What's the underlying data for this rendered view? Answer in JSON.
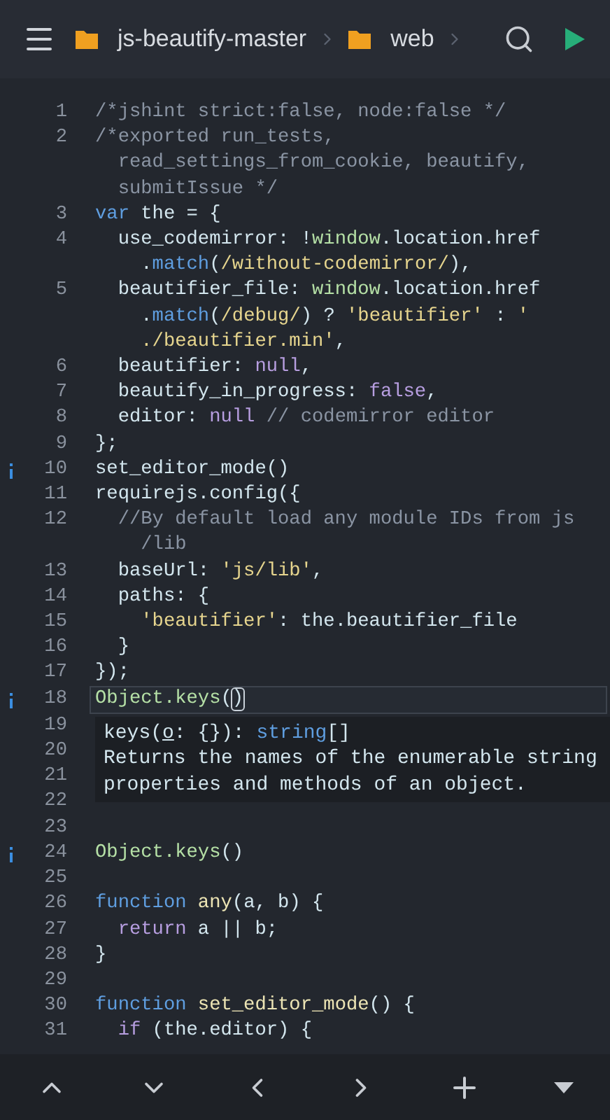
{
  "header": {
    "breadcrumbs": [
      {
        "label": "js-beautify-master"
      },
      {
        "label": "web"
      }
    ]
  },
  "lines": [
    {
      "n": "1",
      "info": false,
      "current": false,
      "rows": [
        {
          "tokens": [
            {
              "text": "/*jshint strict:false, node:false */",
              "kind": "comment"
            }
          ]
        }
      ]
    },
    {
      "n": "2",
      "info": false,
      "current": false,
      "rows": [
        {
          "tokens": [
            {
              "text": "/*exported run_tests,",
              "kind": "comment"
            }
          ]
        },
        {
          "tokens": [
            {
              "text": "  read_settings_from_cookie, beautify,",
              "kind": "comment"
            }
          ]
        },
        {
          "tokens": [
            {
              "text": "  submitIssue */",
              "kind": "comment"
            }
          ]
        }
      ]
    },
    {
      "n": "3",
      "info": false,
      "current": false,
      "rows": [
        {
          "tokens": [
            {
              "text": "var",
              "kind": "keyword"
            },
            {
              "text": " the = {",
              "kind": "ident"
            }
          ]
        }
      ]
    },
    {
      "n": "4",
      "info": false,
      "current": false,
      "rows": [
        {
          "tokens": [
            {
              "text": "  use_codemirror: !",
              "kind": "ident"
            },
            {
              "text": "window",
              "kind": "global"
            },
            {
              "text": ".location.href",
              "kind": "ident"
            }
          ]
        },
        {
          "tokens": [
            {
              "text": "    .",
              "kind": "ident"
            },
            {
              "text": "match",
              "kind": "method"
            },
            {
              "text": "(",
              "kind": "ident"
            },
            {
              "text": "/without-codemirror/",
              "kind": "string"
            },
            {
              "text": "),",
              "kind": "ident"
            }
          ]
        }
      ]
    },
    {
      "n": "5",
      "info": false,
      "current": false,
      "rows": [
        {
          "tokens": [
            {
              "text": "  beautifier_file: ",
              "kind": "ident"
            },
            {
              "text": "window",
              "kind": "global"
            },
            {
              "text": ".location.href",
              "kind": "ident"
            }
          ]
        },
        {
          "tokens": [
            {
              "text": "    .",
              "kind": "ident"
            },
            {
              "text": "match",
              "kind": "method"
            },
            {
              "text": "(",
              "kind": "ident"
            },
            {
              "text": "/debug/",
              "kind": "string"
            },
            {
              "text": ") ? ",
              "kind": "ident"
            },
            {
              "text": "'beautifier'",
              "kind": "string"
            },
            {
              "text": " : ",
              "kind": "ident"
            },
            {
              "text": "'",
              "kind": "string"
            }
          ]
        },
        {
          "tokens": [
            {
              "text": "    ./beautifier.min'",
              "kind": "string"
            },
            {
              "text": ",",
              "kind": "ident"
            }
          ]
        }
      ]
    },
    {
      "n": "6",
      "info": false,
      "current": false,
      "rows": [
        {
          "tokens": [
            {
              "text": "  beautifier: ",
              "kind": "ident"
            },
            {
              "text": "null",
              "kind": "literal"
            },
            {
              "text": ",",
              "kind": "ident"
            }
          ]
        }
      ]
    },
    {
      "n": "7",
      "info": false,
      "current": false,
      "rows": [
        {
          "tokens": [
            {
              "text": "  beautify_in_progress: ",
              "kind": "ident"
            },
            {
              "text": "false",
              "kind": "literal"
            },
            {
              "text": ",",
              "kind": "ident"
            }
          ]
        }
      ]
    },
    {
      "n": "8",
      "info": false,
      "current": false,
      "rows": [
        {
          "tokens": [
            {
              "text": "  editor: ",
              "kind": "ident"
            },
            {
              "text": "null",
              "kind": "literal"
            },
            {
              "text": " // codemirror editor",
              "kind": "comment"
            }
          ]
        }
      ]
    },
    {
      "n": "9",
      "info": false,
      "current": false,
      "rows": [
        {
          "tokens": [
            {
              "text": "};",
              "kind": "ident"
            }
          ]
        }
      ]
    },
    {
      "n": "10",
      "info": true,
      "current": false,
      "rows": [
        {
          "tokens": [
            {
              "text": "set_editor_mode()",
              "kind": "ident"
            }
          ]
        }
      ]
    },
    {
      "n": "11",
      "info": false,
      "current": false,
      "rows": [
        {
          "tokens": [
            {
              "text": "requirejs.config({",
              "kind": "ident"
            }
          ]
        }
      ]
    },
    {
      "n": "12",
      "info": false,
      "current": false,
      "rows": [
        {
          "tokens": [
            {
              "text": "  //By default load any module IDs from js",
              "kind": "comment"
            }
          ]
        },
        {
          "tokens": [
            {
              "text": "    /lib",
              "kind": "comment"
            }
          ]
        }
      ]
    },
    {
      "n": "13",
      "info": false,
      "current": false,
      "rows": [
        {
          "tokens": [
            {
              "text": "  baseUrl: ",
              "kind": "ident"
            },
            {
              "text": "'js/lib'",
              "kind": "string"
            },
            {
              "text": ",",
              "kind": "ident"
            }
          ]
        }
      ]
    },
    {
      "n": "14",
      "info": false,
      "current": false,
      "rows": [
        {
          "tokens": [
            {
              "text": "  paths: {",
              "kind": "ident"
            }
          ]
        }
      ]
    },
    {
      "n": "15",
      "info": false,
      "current": false,
      "rows": [
        {
          "tokens": [
            {
              "text": "    'beautifier'",
              "kind": "string"
            },
            {
              "text": ": the.beautifier_file",
              "kind": "ident"
            }
          ]
        }
      ]
    },
    {
      "n": "16",
      "info": false,
      "current": false,
      "rows": [
        {
          "tokens": [
            {
              "text": "  }",
              "kind": "ident"
            }
          ]
        }
      ]
    },
    {
      "n": "17",
      "info": false,
      "current": false,
      "rows": [
        {
          "tokens": [
            {
              "text": "});",
              "kind": "ident"
            }
          ]
        }
      ]
    },
    {
      "n": "18",
      "info": true,
      "current": true,
      "rows": [
        {
          "tokens": [
            {
              "text": "Object.keys",
              "kind": "global"
            },
            {
              "text": "(",
              "kind": "ident"
            },
            {
              "text": ")",
              "kind": "cursor"
            }
          ]
        }
      ]
    },
    {
      "n": "19",
      "info": false,
      "current": false
    },
    {
      "n": "20",
      "info": false,
      "current": false
    },
    {
      "n": "21",
      "info": false,
      "current": false
    },
    {
      "n": "22",
      "info": false,
      "current": false
    },
    {
      "n": "23",
      "info": false,
      "current": false
    },
    {
      "n": "24",
      "info": true,
      "current": false,
      "rows": [
        {
          "tokens": [
            {
              "text": "Object.keys",
              "kind": "global"
            },
            {
              "text": "()",
              "kind": "ident"
            }
          ]
        }
      ]
    },
    {
      "n": "25",
      "info": false,
      "current": false
    },
    {
      "n": "26",
      "info": false,
      "current": false,
      "rows": [
        {
          "tokens": [
            {
              "text": "function",
              "kind": "keyword"
            },
            {
              "text": " any",
              "kind": "fn"
            },
            {
              "text": "(a, b) {",
              "kind": "ident"
            }
          ]
        }
      ]
    },
    {
      "n": "27",
      "info": false,
      "current": false,
      "rows": [
        {
          "tokens": [
            {
              "text": "  return",
              "kind": "literal"
            },
            {
              "text": " a || b;",
              "kind": "ident"
            }
          ]
        }
      ]
    },
    {
      "n": "28",
      "info": false,
      "current": false,
      "rows": [
        {
          "tokens": [
            {
              "text": "}",
              "kind": "ident"
            }
          ]
        }
      ]
    },
    {
      "n": "29",
      "info": false,
      "current": false
    },
    {
      "n": "30",
      "info": false,
      "current": false,
      "rows": [
        {
          "tokens": [
            {
              "text": "function",
              "kind": "keyword"
            },
            {
              "text": " set_editor_mode",
              "kind": "fn"
            },
            {
              "text": "() {",
              "kind": "ident"
            }
          ]
        }
      ]
    },
    {
      "n": "31",
      "info": false,
      "current": false,
      "rows": [
        {
          "tokens": [
            {
              "text": "  if",
              "kind": "literal"
            },
            {
              "text": " (the.editor) {",
              "kind": "ident"
            }
          ]
        }
      ]
    }
  ],
  "tooltip": {
    "signature": [
      {
        "text": "keys(",
        "kind": "ident"
      },
      {
        "text": "o",
        "kind": "param"
      },
      {
        "text": ": {}): ",
        "kind": "ident"
      },
      {
        "text": "string",
        "kind": "keyword"
      },
      {
        "text": "[]",
        "kind": "ident"
      }
    ],
    "description": [
      "Returns the names of the enumerable string",
      "properties and methods of an object."
    ]
  }
}
